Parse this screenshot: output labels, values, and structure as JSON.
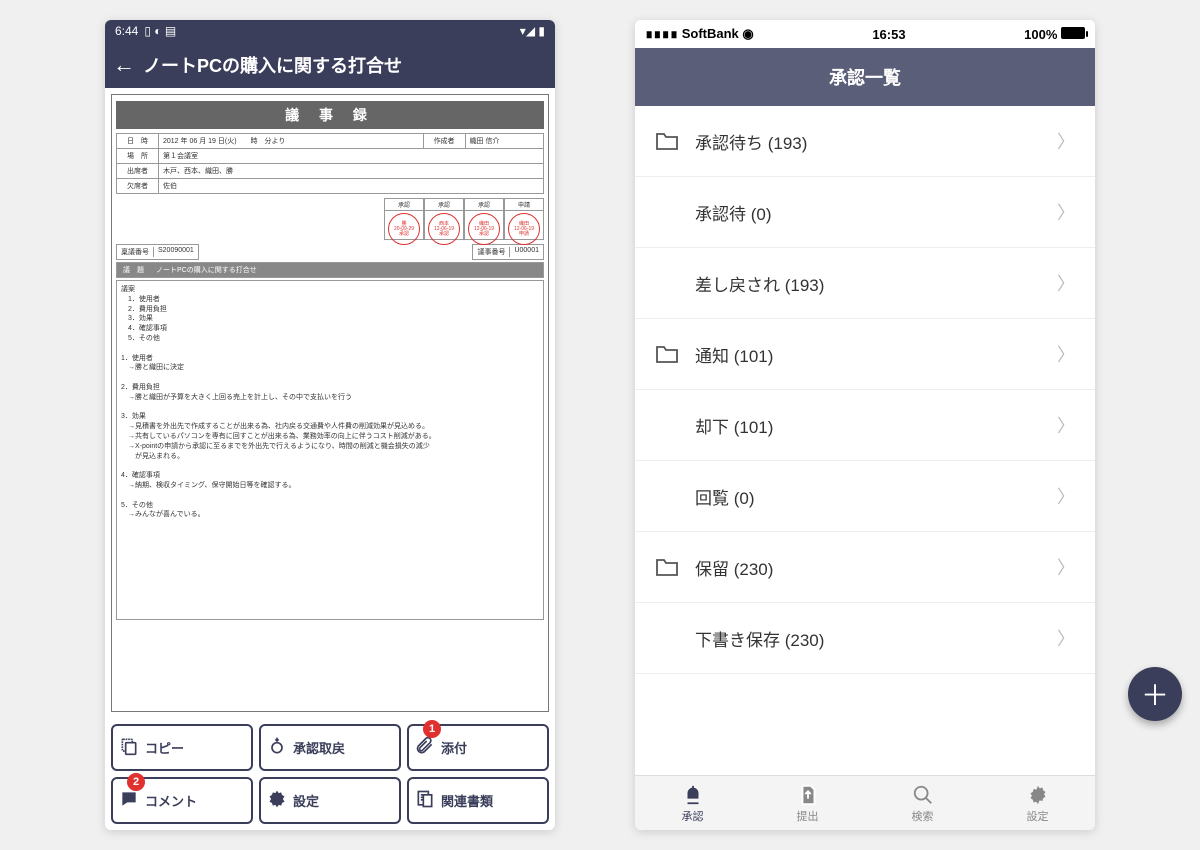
{
  "left": {
    "status": {
      "time": "6:44",
      "icons": "▯ ◐ ▤",
      "right_icons": "▾◢ ▮"
    },
    "title": "ノートPCの購入に関する打合せ",
    "doc": {
      "header": "議 事 録",
      "date_label": "日　時",
      "date_value": "2012 年 06 月 19 日(火)　　時　分より",
      "author_label": "作成者",
      "author_value": "織田 信介",
      "place_label": "場　所",
      "place_value": "第１会議室",
      "attendee_label": "出席者",
      "attendee_value": "木戸、西本、織田、勝",
      "absent_label": "欠席者",
      "absent_value": "佐伯",
      "stamps": [
        {
          "head": "承認",
          "name": "勝",
          "date": "20-09-29",
          "state": "承認"
        },
        {
          "head": "承認",
          "name": "西本",
          "date": "12-06-19",
          "state": "承認"
        },
        {
          "head": "承認",
          "name": "織田",
          "date": "12-06-19",
          "state": "承認"
        },
        {
          "head": "申請",
          "name": "織田",
          "date": "12-06-19",
          "state": "申請"
        }
      ],
      "id1_label": "稟議番号",
      "id1_value": "S20090001",
      "id2_label": "議事番号",
      "id2_value": "U00001",
      "subject_label": "議　題",
      "subject_value": "ノートPCの購入に関する打合せ",
      "body": "議案\n　1．使用者\n　2．費用負担\n　3．効果\n　4．確認事項\n　5．その他\n\n1．使用者\n　→勝と織田に決定\n\n2．費用負担\n　→勝と織田が予算を大きく上回る売上を計上し、その中で支払いを行う\n\n3．効果\n　→見積書を外出先で作成することが出来る為、社内戻る交通費や人件費の削減効果が見込める。\n　→共有しているパソコンを専有に回すことが出来る為、業務効率の向上に伴うコスト削減がある。\n　→X-pointの申請から承認に至るまでを外出先で行えるようになり、時間の削減と機会損失の減少\n　　が見込まれる。\n\n4．確認事項\n　→納期、検収タイミング、保守開始日等を確認する。\n\n5．その他\n　→みんなが喜んでいる。"
    },
    "fab": "＋",
    "actions": [
      {
        "key": "copy",
        "label": "コピー",
        "badge": null
      },
      {
        "key": "recall",
        "label": "承認取戻",
        "badge": null
      },
      {
        "key": "attach",
        "label": "添付",
        "badge": "1"
      },
      {
        "key": "comment",
        "label": "コメント",
        "badge": "2"
      },
      {
        "key": "settings",
        "label": "設定",
        "badge": null
      },
      {
        "key": "related",
        "label": "関連書類",
        "badge": null
      }
    ]
  },
  "right": {
    "status": {
      "carrier": "SoftBank",
      "time": "16:53",
      "battery": "100%"
    },
    "title": "承認一覧",
    "items": [
      {
        "folder": true,
        "label": "承認待ち (193)"
      },
      {
        "folder": false,
        "label": "承認待 (0)"
      },
      {
        "folder": false,
        "label": "差し戻され (193)"
      },
      {
        "folder": true,
        "label": "通知 (101)"
      },
      {
        "folder": false,
        "label": "却下 (101)"
      },
      {
        "folder": false,
        "label": "回覧 (0)"
      },
      {
        "folder": true,
        "label": "保留 (230)"
      },
      {
        "folder": false,
        "label": "下書き保存 (230)"
      }
    ],
    "tabs": [
      {
        "key": "approve",
        "label": "承認",
        "active": true
      },
      {
        "key": "submit",
        "label": "提出",
        "active": false
      },
      {
        "key": "search",
        "label": "検索",
        "active": false
      },
      {
        "key": "config",
        "label": "設定",
        "active": false
      }
    ]
  }
}
